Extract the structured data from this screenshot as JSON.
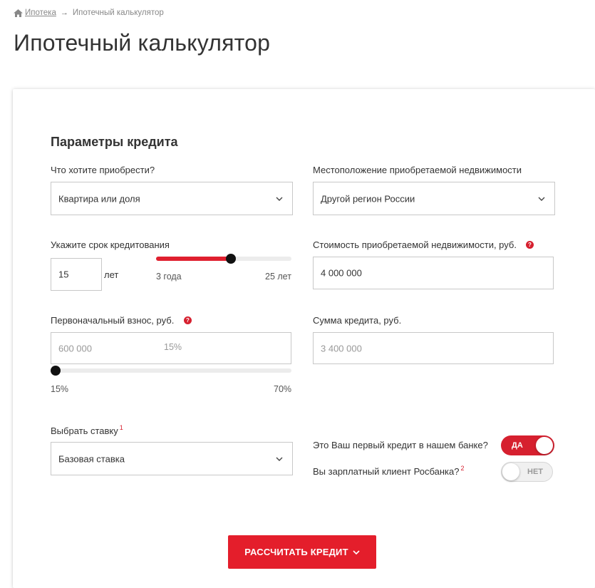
{
  "breadcrumb": {
    "home_link": "Ипотека",
    "separator": "→",
    "current": "Ипотечный калькулятор"
  },
  "page_title": "Ипотечный калькулятор",
  "section_title": "Параметры кредита",
  "form": {
    "purchase": {
      "label": "Что хотите приобрести?",
      "value": "Квартира или доля"
    },
    "location": {
      "label": "Местоположение приобретаемой недвижимости",
      "value": "Другой регион России"
    },
    "term": {
      "label": "Укажите срок кредитования",
      "value": "15",
      "unit": "лет",
      "slider_min": "3 года",
      "slider_max": "25 лет",
      "slider_level": 0.55
    },
    "property_cost": {
      "label": "Стоимость приобретаемой недвижимости, руб.",
      "help": "?",
      "value": "4 000 000"
    },
    "down_payment": {
      "label": "Первоначальный взнос, руб.",
      "help": "?",
      "placeholder": "600 000",
      "percent": "15%",
      "slider_min": "15%",
      "slider_max": "70%",
      "slider_level": 0
    },
    "loan_amount": {
      "label": "Сумма кредита, руб.",
      "placeholder": "3 400 000"
    },
    "rate": {
      "label": "Выбрать ставку",
      "footnote": "1",
      "value": "Базовая ставка"
    },
    "first_credit": {
      "label": "Это Ваш первый кредит в нашем банке?",
      "toggle_label": "ДА",
      "on": true
    },
    "salary_client": {
      "label": "Вы зарплатный клиент Росбанка?",
      "footnote": "2",
      "toggle_label": "НЕТ",
      "on": false
    }
  },
  "calculate_button": {
    "label": "РАССЧИТАТЬ КРЕДИТ"
  },
  "icons": {
    "home": "home-icon",
    "chevron": "chevron-down-icon",
    "help": "question-icon"
  },
  "colors": {
    "accent": "#e41e2b",
    "text": "#333333",
    "muted": "#999999",
    "border": "#c8c8c8",
    "slider_track": "#ececec",
    "slider_thumb": "#111111"
  }
}
